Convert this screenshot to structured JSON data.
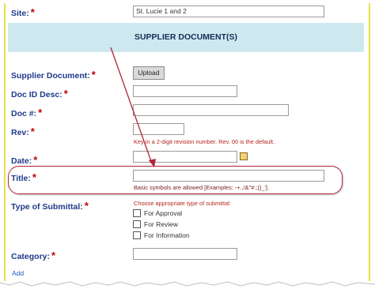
{
  "site": {
    "label": "Site:",
    "value": "St. Lucie 1 and 2"
  },
  "section_title": "SUPPLIER DOCUMENT(S)",
  "fields": {
    "supplier_document": {
      "label": "Supplier Document:",
      "button": "Upload"
    },
    "doc_id_desc": {
      "label": "Doc ID Desc:"
    },
    "doc_number": {
      "label": "Doc #:"
    },
    "rev": {
      "label": "Rev:",
      "hint": "Key in a 2-digit revision number. Rev. 00 is the default."
    },
    "date": {
      "label": "Date:"
    },
    "title": {
      "label": "Title:",
      "hint": "Basic symbols are allowed [Examples: -+.,/&\"#:;()_']."
    },
    "type_of_submittal": {
      "label": "Type of Submittal:",
      "hint": "Choose appropriate type of submittal:",
      "options": [
        "For Approval",
        "For Review",
        "For Information"
      ]
    },
    "category": {
      "label": "Category:"
    }
  },
  "required_marker": "*",
  "add_link": "Add"
}
